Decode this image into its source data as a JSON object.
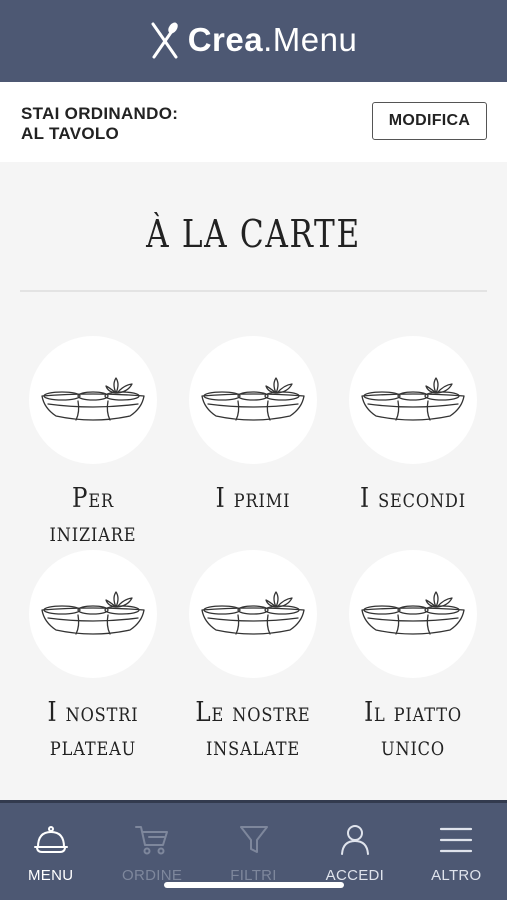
{
  "header": {
    "brand_bold": "Crea",
    "brand_light": ".Menu",
    "logo_icon": "fork-knife-icon"
  },
  "order": {
    "label_line1": "STAI ORDINANDO:",
    "label_line2": "AL TAVOLO",
    "modify_label": "MODIFICA"
  },
  "section": {
    "title": "À LA CARTE"
  },
  "categories": [
    {
      "line1": "Per iniziare",
      "line2": ""
    },
    {
      "line1": "I primi",
      "line2": ""
    },
    {
      "line1": "I secondi",
      "line2": ""
    },
    {
      "line1": "I nostri",
      "line2": "plateau"
    },
    {
      "line1": "Le nostre",
      "line2": "insalate"
    },
    {
      "line1": "Il piatto",
      "line2": "unico"
    }
  ],
  "tabs": [
    {
      "label": "MENU",
      "icon": "cloche-icon",
      "state": "active"
    },
    {
      "label": "ORDINE",
      "icon": "cart-icon",
      "state": "disabled"
    },
    {
      "label": "FILTRI",
      "icon": "filter-icon",
      "state": "disabled"
    },
    {
      "label": "ACCEDI",
      "icon": "user-icon",
      "state": "normal"
    },
    {
      "label": "ALTRO",
      "icon": "hamburger-icon",
      "state": "normal"
    }
  ],
  "colors": {
    "bar": "#4d5873",
    "background": "#f5f5f5",
    "active_tab": "#ffffff",
    "disabled_tab": "#7e879c"
  }
}
